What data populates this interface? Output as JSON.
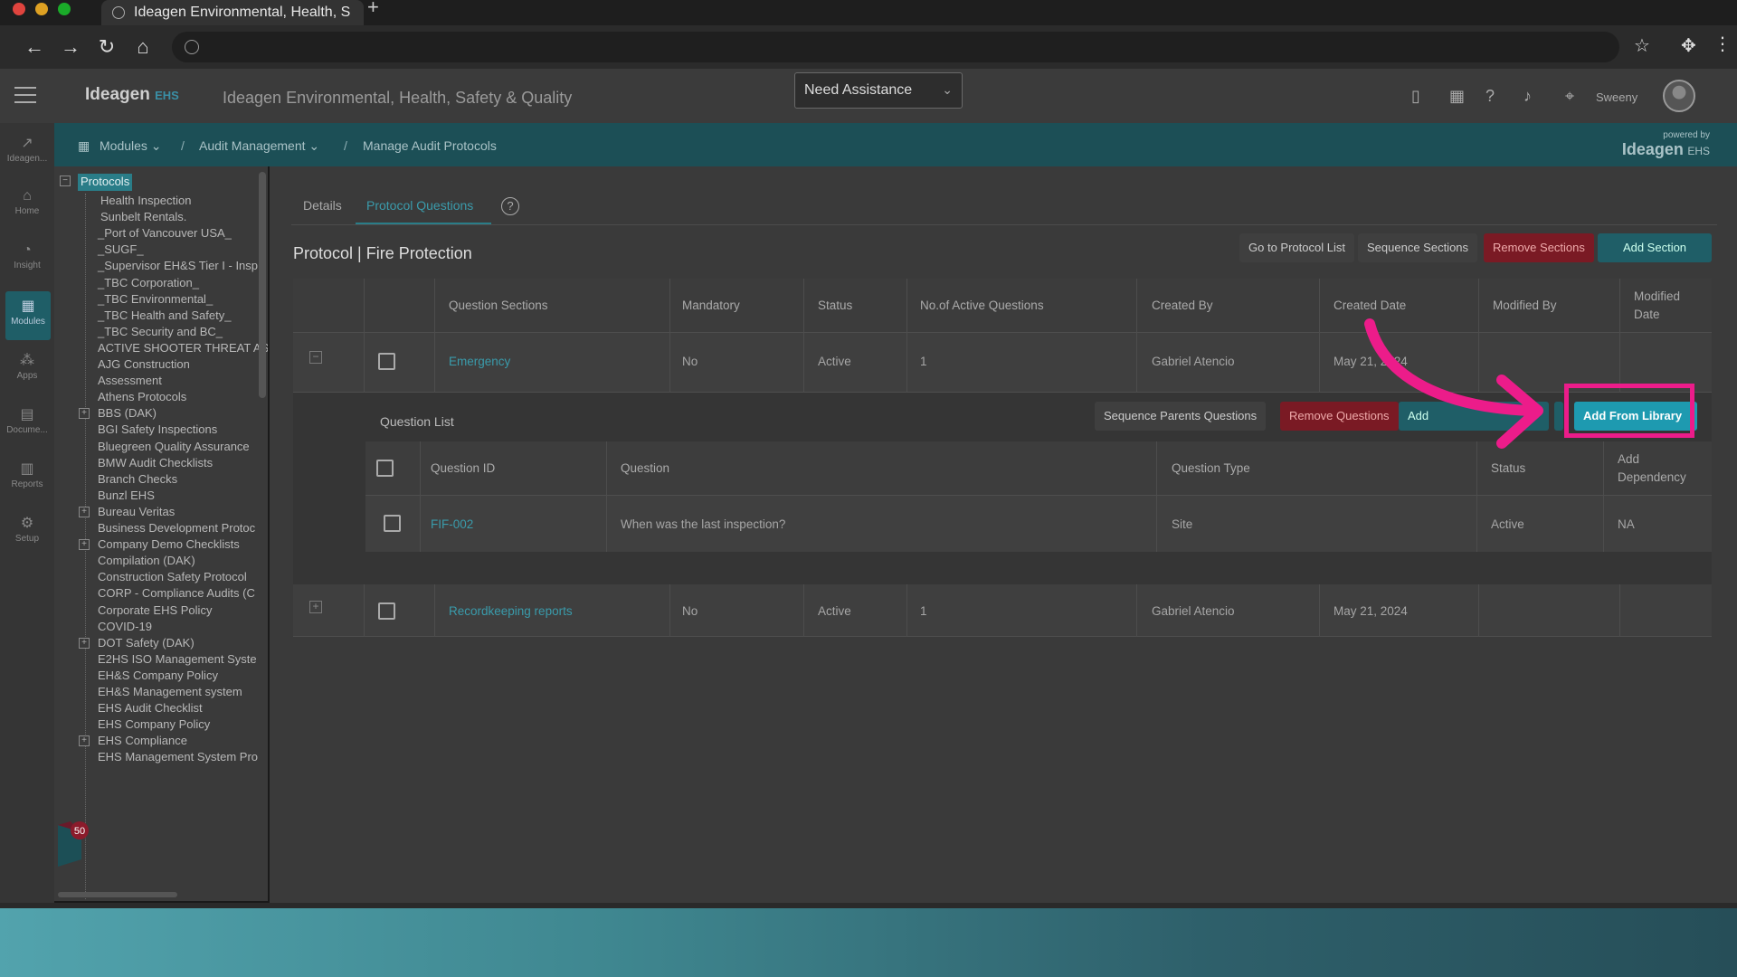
{
  "browser": {
    "tab_title": "Ideagen Environmental, Health, S",
    "new_tab": "+"
  },
  "header": {
    "logo_main": "Ideagen",
    "logo_sub": "EHS",
    "app_title": "Ideagen Environmental, Health, Safety & Quality",
    "assistance": "Need Assistance",
    "user_name": "Sweeny"
  },
  "rail": {
    "items": [
      {
        "icon": "ideagen-icon",
        "label": "Ideagen..."
      },
      {
        "icon": "home-icon",
        "label": "Home"
      },
      {
        "icon": "insight-icon",
        "label": "Insight"
      },
      {
        "icon": "modules-icon",
        "label": "Modules"
      },
      {
        "icon": "apps-icon",
        "label": "Apps"
      },
      {
        "icon": "document-icon",
        "label": "Docume..."
      },
      {
        "icon": "reports-icon",
        "label": "Reports"
      },
      {
        "icon": "setup-icon",
        "label": "Setup"
      }
    ]
  },
  "breadcrumb": {
    "modules": "Modules",
    "sep1": "/",
    "audit": "Audit Management",
    "sep2": "/",
    "current": "Manage Audit Protocols",
    "powered_by": "powered by",
    "powered_logo": "Ideagen",
    "powered_sub": "EHS"
  },
  "tree": {
    "root": "Protocols",
    "items": [
      "Health Inspection",
      "Sunbelt Rentals.",
      "_Port of Vancouver USA_",
      "_SUGF_",
      "_Supervisor EH&S Tier I - Insp",
      "_TBC Corporation_",
      "_TBC Environmental_",
      "_TBC Health and Safety_",
      "_TBC Security and BC_",
      "ACTIVE SHOOTER THREAT AS",
      "AJG Construction",
      "Assessment",
      "Athens Protocols",
      "BBS (DAK)",
      "BGI Safety Inspections",
      "Bluegreen Quality Assurance",
      "BMW Audit Checklists",
      "Branch Checks",
      "Bunzl EHS",
      "Bureau Veritas",
      "Business Development Protoc",
      "Company Demo Checklists",
      "Compilation (DAK)",
      "Construction Safety Protocol",
      "CORP - Compliance Audits (C",
      "Corporate EHS Policy",
      "COVID-19",
      "DOT Safety (DAK)",
      "E2HS ISO Management Syste",
      "EH&S Company Policy",
      "EH&S Management system",
      "EHS Audit Checklist",
      "EHS Company Policy",
      "EHS Compliance",
      "EHS Management System Pro"
    ],
    "badge": "50"
  },
  "tabs": {
    "details": "Details",
    "protocol_questions": "Protocol Questions",
    "help": "?"
  },
  "protocol": {
    "title": "Protocol | Fire Protection",
    "buttons": {
      "go_to_list": "Go to Protocol List",
      "sequence_sections": "Sequence Sections",
      "remove_sections": "Remove Sections",
      "add_section": "Add Section"
    }
  },
  "sections_table": {
    "headers": {
      "question_sections": "Question Sections",
      "mandatory": "Mandatory",
      "status": "Status",
      "active_questions": "No.of Active Questions",
      "created_by": "Created By",
      "created_date": "Created Date",
      "modified_by": "Modified By",
      "modified_date_1": "Modified",
      "modified_date_2": "Date"
    },
    "rows": [
      {
        "section": "Emergency",
        "mandatory": "No",
        "status": "Active",
        "count": "1",
        "created_by": "Gabriel Atencio",
        "created_date": "May 21, 2024",
        "modified_by": "",
        "modified_date": ""
      },
      {
        "section": "Recordkeeping reports",
        "mandatory": "No",
        "status": "Active",
        "count": "1",
        "created_by": "Gabriel Atencio",
        "created_date": "May 21, 2024",
        "modified_by": "",
        "modified_date": ""
      }
    ]
  },
  "question_list": {
    "title": "Question List",
    "buttons": {
      "sequence_parents": "Sequence Parents Questions",
      "remove_questions": "Remove Questions",
      "add_question": "Add",
      "add_from_library": "Add From Library"
    },
    "headers": {
      "question_id": "Question ID",
      "question": "Question",
      "question_type": "Question Type",
      "status": "Status",
      "add_dependency_1": "Add",
      "add_dependency_2": "Dependency"
    },
    "rows": [
      {
        "id": "FIF-002",
        "question": "When was the last inspection?",
        "type": "Site",
        "status": "Active",
        "dependency": "NA"
      }
    ]
  },
  "annotation": {
    "highlight_color": "#ec1c8a"
  }
}
